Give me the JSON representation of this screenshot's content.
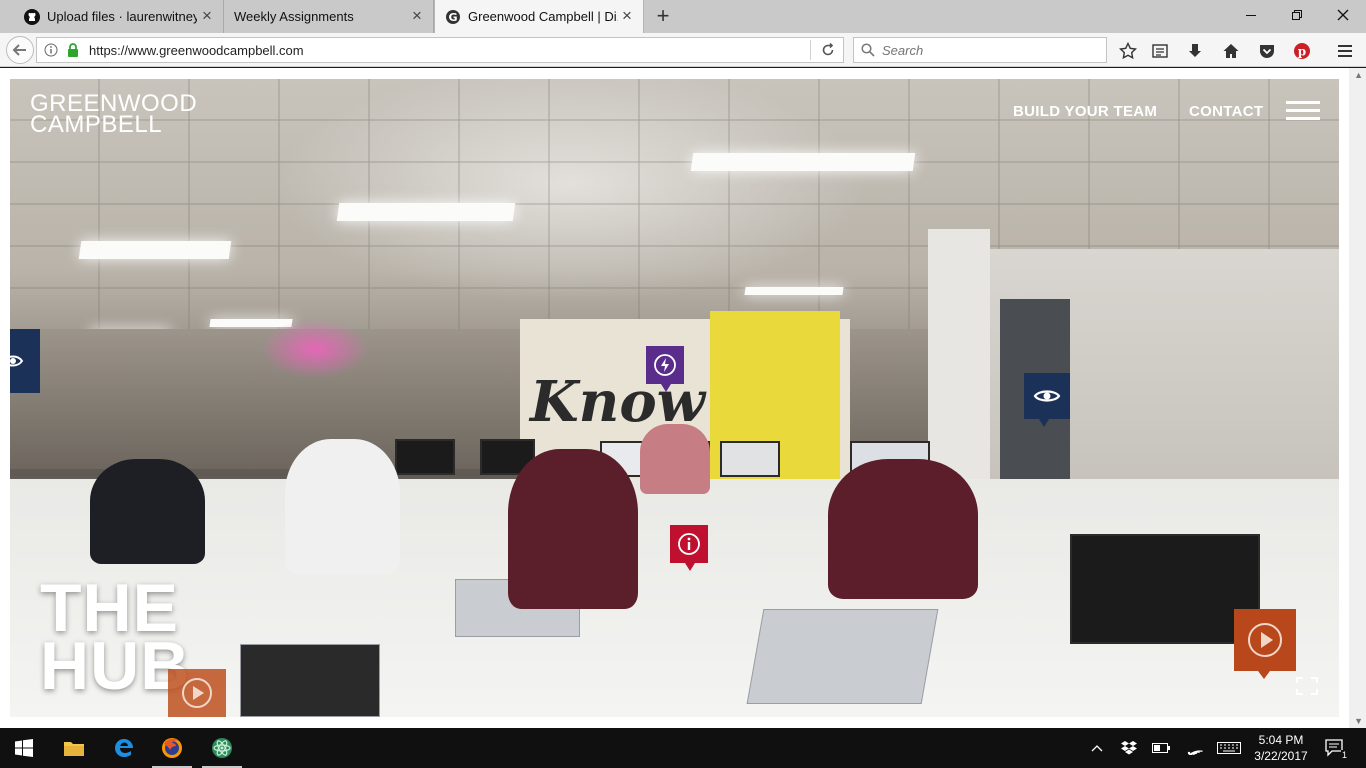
{
  "browser": {
    "tabs": [
      {
        "title": "Upload files · laurenwitney...",
        "favicon": "github-icon"
      },
      {
        "title": "Weekly Assignments",
        "favicon": "none"
      },
      {
        "title": "Greenwood Campbell | Di...",
        "favicon": "greenwood-g-icon",
        "active": true
      }
    ],
    "url": "https://www.greenwoodcampbell.com",
    "search_placeholder": "Search"
  },
  "site": {
    "logo_line1": "GREENWOOD",
    "logo_line2": "CAMPBELL",
    "nav": {
      "build_team": "BUILD YOUR TEAM",
      "contact": "CONTACT"
    },
    "hero_title_line1": "THE",
    "hero_title_line2": "HUB",
    "mural_text": "Know",
    "colors": {
      "hotspot_purple": "#5a2d8c",
      "hotspot_navy": "#1b3157",
      "hotspot_red": "#c0102f",
      "play_orange": "#b8481c"
    }
  },
  "taskbar": {
    "time": "5:04 PM",
    "date": "3/22/2017",
    "notification_count": "1"
  }
}
